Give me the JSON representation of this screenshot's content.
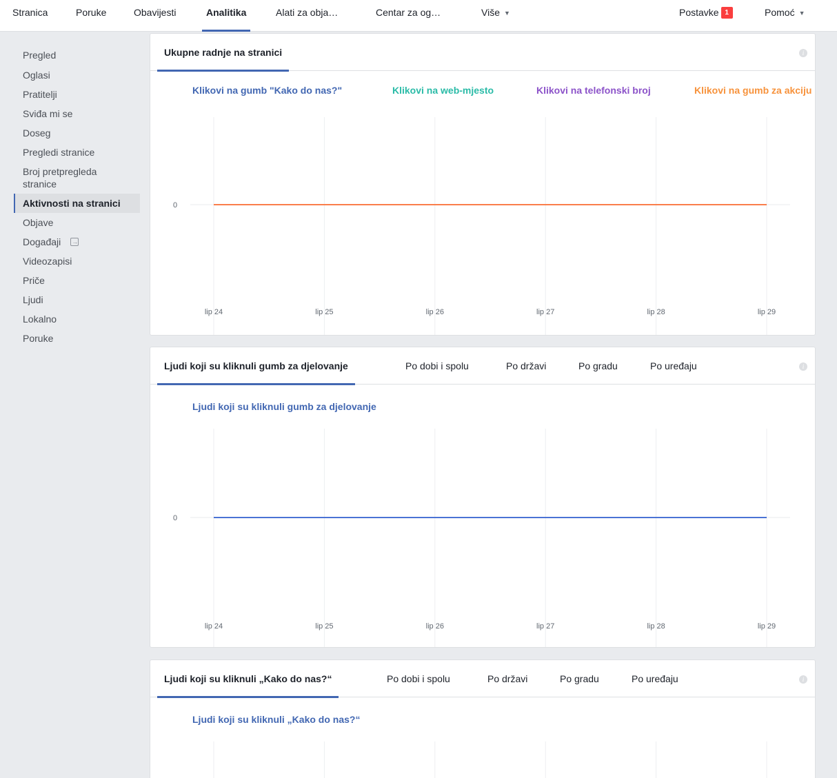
{
  "topnav": {
    "items": [
      {
        "label": "Stranica"
      },
      {
        "label": "Poruke"
      },
      {
        "label": "Obavijesti"
      },
      {
        "label": "Analitika"
      },
      {
        "label": "Alati za obja…"
      },
      {
        "label": "Centar za og…"
      },
      {
        "label": "Više"
      }
    ],
    "settings_label": "Postavke",
    "settings_badge": "1",
    "help_label": "Pomoć"
  },
  "sidebar": {
    "items": [
      {
        "label": "Pregled"
      },
      {
        "label": "Oglasi"
      },
      {
        "label": "Pratitelji"
      },
      {
        "label": "Sviđa mi se"
      },
      {
        "label": "Doseg"
      },
      {
        "label": "Pregledi stranice"
      },
      {
        "label": "Broj pretpregleda stranice"
      },
      {
        "label": "Aktivnosti na stranici",
        "active": true
      },
      {
        "label": "Objave"
      },
      {
        "label": "Događaji",
        "icon": "external-link-icon"
      },
      {
        "label": "Videozapisi"
      },
      {
        "label": "Priče"
      },
      {
        "label": "Ljudi"
      },
      {
        "label": "Lokalno"
      },
      {
        "label": "Poruke"
      }
    ]
  },
  "cards": [
    {
      "tabs": [
        "Ukupne radnje na stranici"
      ],
      "legend": [
        {
          "label": "Klikovi na gumb \"Kako do nas?\"",
          "color": "#4267b2"
        },
        {
          "label": "Klikovi na web-mjesto",
          "color": "#2abba7"
        },
        {
          "label": "Klikovi na telefonski broj",
          "color": "#8c53c9"
        },
        {
          "label": "Klikovi na gumb za akciju",
          "color": "#f7923b"
        }
      ]
    },
    {
      "tabs": [
        "Ljudi koji su kliknuli gumb za djelovanje",
        "Po dobi i spolu",
        "Po državi",
        "Po gradu",
        "Po uređaju"
      ],
      "legend": [
        {
          "label": "Ljudi koji su kliknuli gumb za djelovanje",
          "color": "#4267b2"
        }
      ]
    },
    {
      "tabs": [
        "Ljudi koji su kliknuli „Kako do nas?“",
        "Po dobi i spolu",
        "Po državi",
        "Po gradu",
        "Po uređaju"
      ],
      "legend": [
        {
          "label": "Ljudi koji su kliknuli „Kako do nas?“",
          "color": "#4267b2"
        }
      ]
    }
  ],
  "chart_data": [
    {
      "type": "line",
      "x": [
        "lip 24",
        "lip 25",
        "lip 26",
        "lip 27",
        "lip 28",
        "lip 29"
      ],
      "y_ticks": [
        "0"
      ],
      "series": [
        {
          "name": "Klikovi na gumb \"Kako do nas?\"",
          "color": "#4267b2",
          "values": [
            0,
            0,
            0,
            0,
            0,
            0
          ]
        },
        {
          "name": "Klikovi na web-mjesto",
          "color": "#2abba7",
          "values": [
            0,
            0,
            0,
            0,
            0,
            0
          ]
        },
        {
          "name": "Klikovi na telefonski broj",
          "color": "#8c53c9",
          "values": [
            0,
            0,
            0,
            0,
            0,
            0
          ]
        },
        {
          "name": "Klikovi na gumb za akciju",
          "color": "#fa7d4a",
          "values": [
            0,
            0,
            0,
            0,
            0,
            0
          ]
        }
      ]
    },
    {
      "type": "line",
      "x": [
        "lip 24",
        "lip 25",
        "lip 26",
        "lip 27",
        "lip 28",
        "lip 29"
      ],
      "y_ticks": [
        "0"
      ],
      "series": [
        {
          "name": "Ljudi koji su kliknuli gumb za djelovanje",
          "color": "#4a72d5",
          "values": [
            0,
            0,
            0,
            0,
            0,
            0
          ]
        }
      ]
    }
  ]
}
